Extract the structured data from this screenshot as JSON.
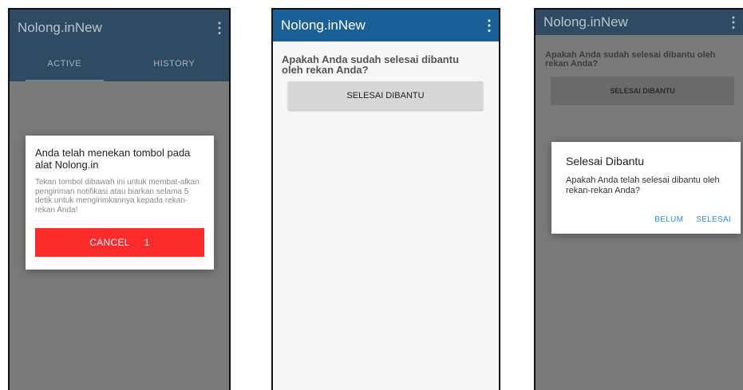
{
  "screen1": {
    "app_title": "Nolong.inNew",
    "tabs": [
      "ACTIVE",
      "HISTORY"
    ],
    "dialog": {
      "title": "Anda telah menekan tombol pada alat Nolong.in",
      "body": "Tekan tombol dibawah ini untuk membat-alkan pengiriman notifikasi atau biarkan selama 5 detik untuk mengirimkannya kepada rekan-rekan Anda!",
      "cancel_label": "CANCEL",
      "countdown": "1"
    }
  },
  "screen2": {
    "app_title": "Nolong.inNew",
    "question": "Apakah Anda sudah selesai dibantu oleh rekan Anda?",
    "button_label": "SELESAI DIBANTU"
  },
  "screen3": {
    "app_title": "Nolong.inNew",
    "question": "Apakah Anda sudah selesai dibantu oleh rekan Anda?",
    "button_label": "SELESAI DIBANTU",
    "dialog": {
      "title": "Selesai Dibantu",
      "body": "Apakah Anda telah selesai dibantu oleh rekan-rekan Anda?",
      "negative_label": "BELUM",
      "positive_label": "SELESAI"
    }
  },
  "icons": {
    "overflow_menu": "more-vertical-icon"
  },
  "colors": {
    "appbar_blue": "#1a5f96",
    "cancel_red": "#fb2b2b",
    "dialog_action_blue": "#2793d8"
  }
}
